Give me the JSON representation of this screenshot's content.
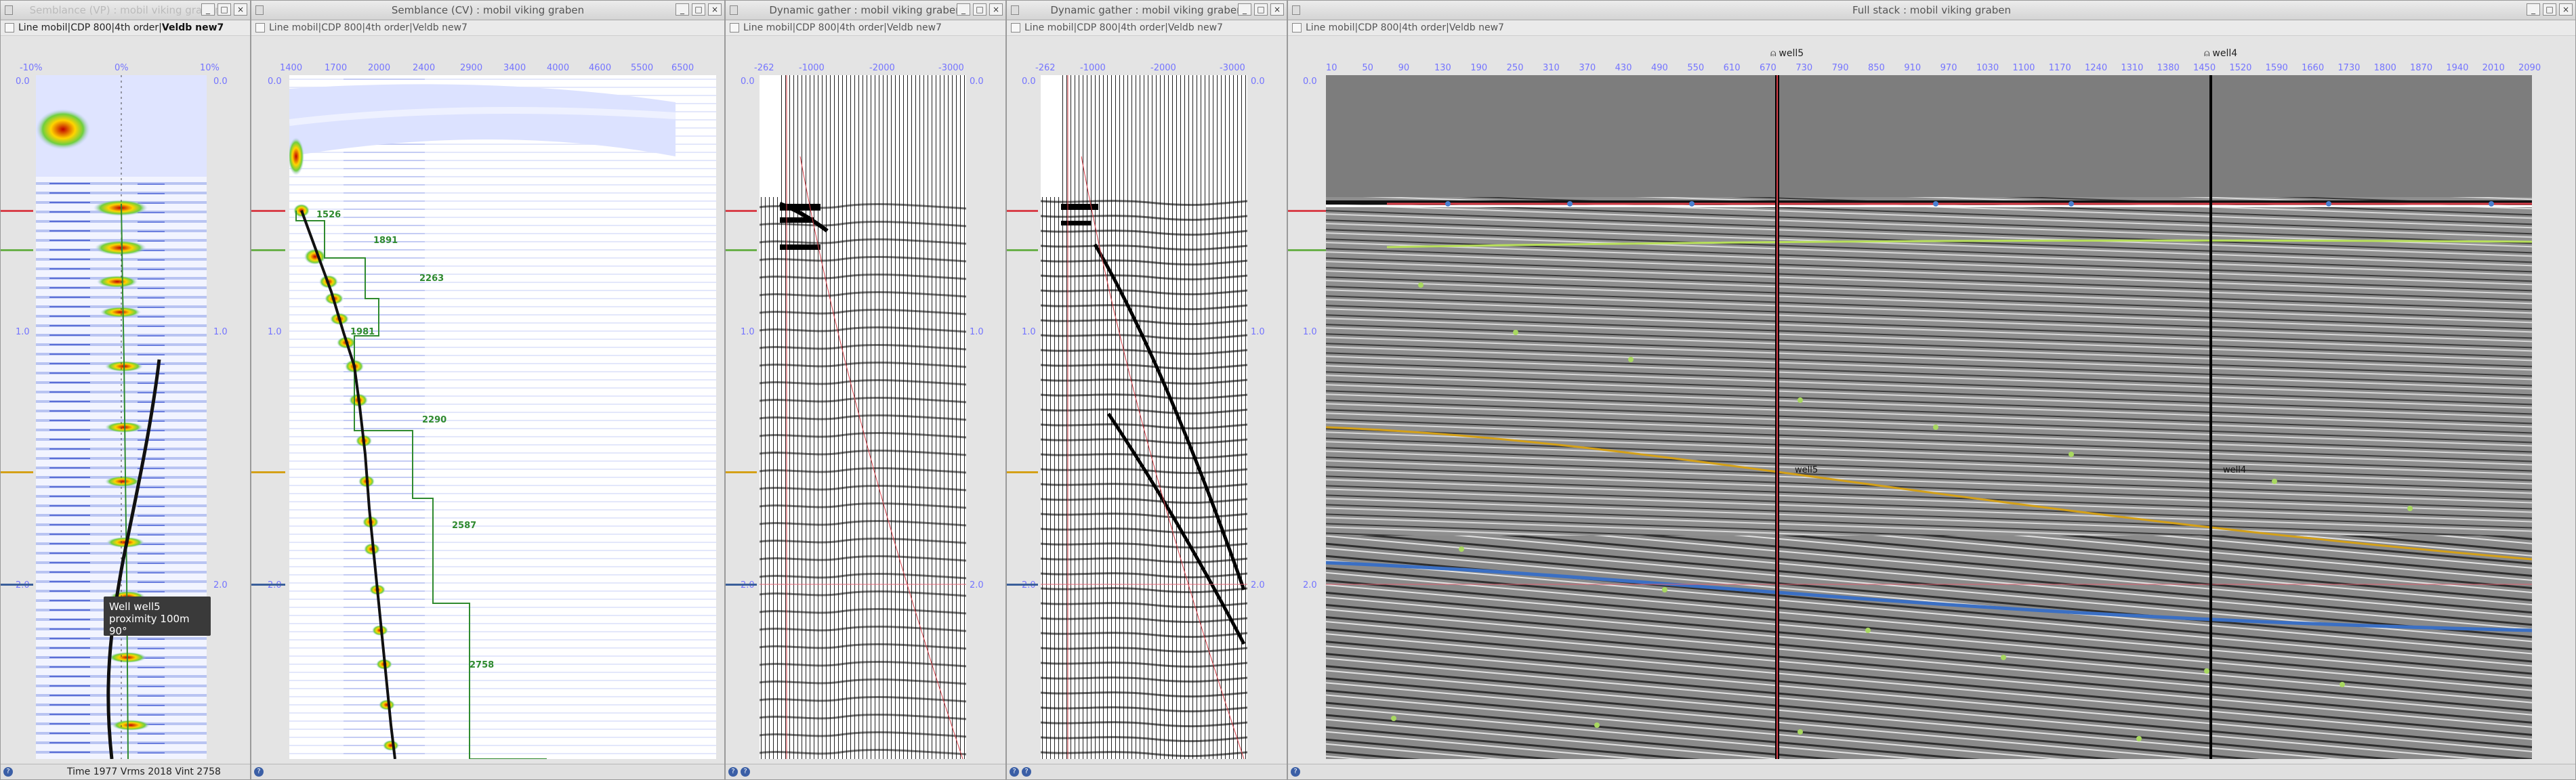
{
  "colors": {
    "red_horizon": "#d8404a",
    "green_horizon": "#6ab04a",
    "orange_horizon": "#d4a017",
    "blue_horizon": "#3a5f9a",
    "axis_blue": "#7474ff",
    "guide_green": "#2f8a2f"
  },
  "win1": {
    "title": "Semblance (VP) : mobil viking graben",
    "toolbar_prefix": "Line mobil|CDP 800|4th order|",
    "toolbar_active": "Veldb new7",
    "x_ticks": [
      "-10%",
      "0%",
      "10%"
    ],
    "y_ticks": [
      "0.0",
      "1.0",
      "2.0"
    ],
    "tooltip": {
      "line1": "Well well5",
      "line2": "proximity 100m  90°"
    },
    "status": "Time 1977 Vrms 2018 Vint 2758"
  },
  "win2": {
    "title": "Semblance (CV) : mobil viking graben",
    "toolbar": "Line mobil|CDP 800|4th order|Veldb new7",
    "x_ticks": [
      "1400",
      "1700",
      "2000",
      "2400",
      "2900",
      "3400",
      "4000",
      "4600",
      "5500",
      "6500"
    ],
    "y_ticks": [
      "0.0",
      "1.0",
      "2.0"
    ],
    "interval_labels": [
      "1526",
      "1891",
      "2263",
      "1981",
      "2290",
      "2587",
      "2758"
    ]
  },
  "win3": {
    "title": "Dynamic gather : mobil viking graben",
    "toolbar": "Line mobil|CDP 800|4th order|Veldb new7",
    "x_ticks": [
      "-262",
      "-1000",
      "-2000",
      "-3000"
    ],
    "y_ticks": [
      "0.0",
      "1.0",
      "2.0"
    ]
  },
  "win4": {
    "title": "Dynamic gather : mobil viking graben",
    "toolbar": "Line mobil|CDP 800|4th order|Veldb new7",
    "x_ticks": [
      "-262",
      "-1000",
      "-2000",
      "-3000"
    ],
    "y_ticks": [
      "0.0",
      "1.0",
      "2.0"
    ]
  },
  "win5": {
    "title": "Full stack : mobil viking graben",
    "toolbar": "Line mobil|CDP 800|4th order|Veldb new7",
    "x_ticks": [
      "10",
      "50",
      "90",
      "130",
      "190",
      "250",
      "310",
      "370",
      "430",
      "490",
      "550",
      "610",
      "670",
      "730",
      "790",
      "850",
      "910",
      "970",
      "1030",
      "1100",
      "1170",
      "1240",
      "1310",
      "1380",
      "1450",
      "1520",
      "1590",
      "1660",
      "1730",
      "1800",
      "1870",
      "1940",
      "2010",
      "2090"
    ],
    "y_ticks": [
      "0.0",
      "1.0",
      "2.0"
    ],
    "well_labels": [
      "well5",
      "well4"
    ]
  },
  "window_buttons": {
    "minimize": "_",
    "maximize": "□",
    "close": "×"
  },
  "help_glyph": "?"
}
